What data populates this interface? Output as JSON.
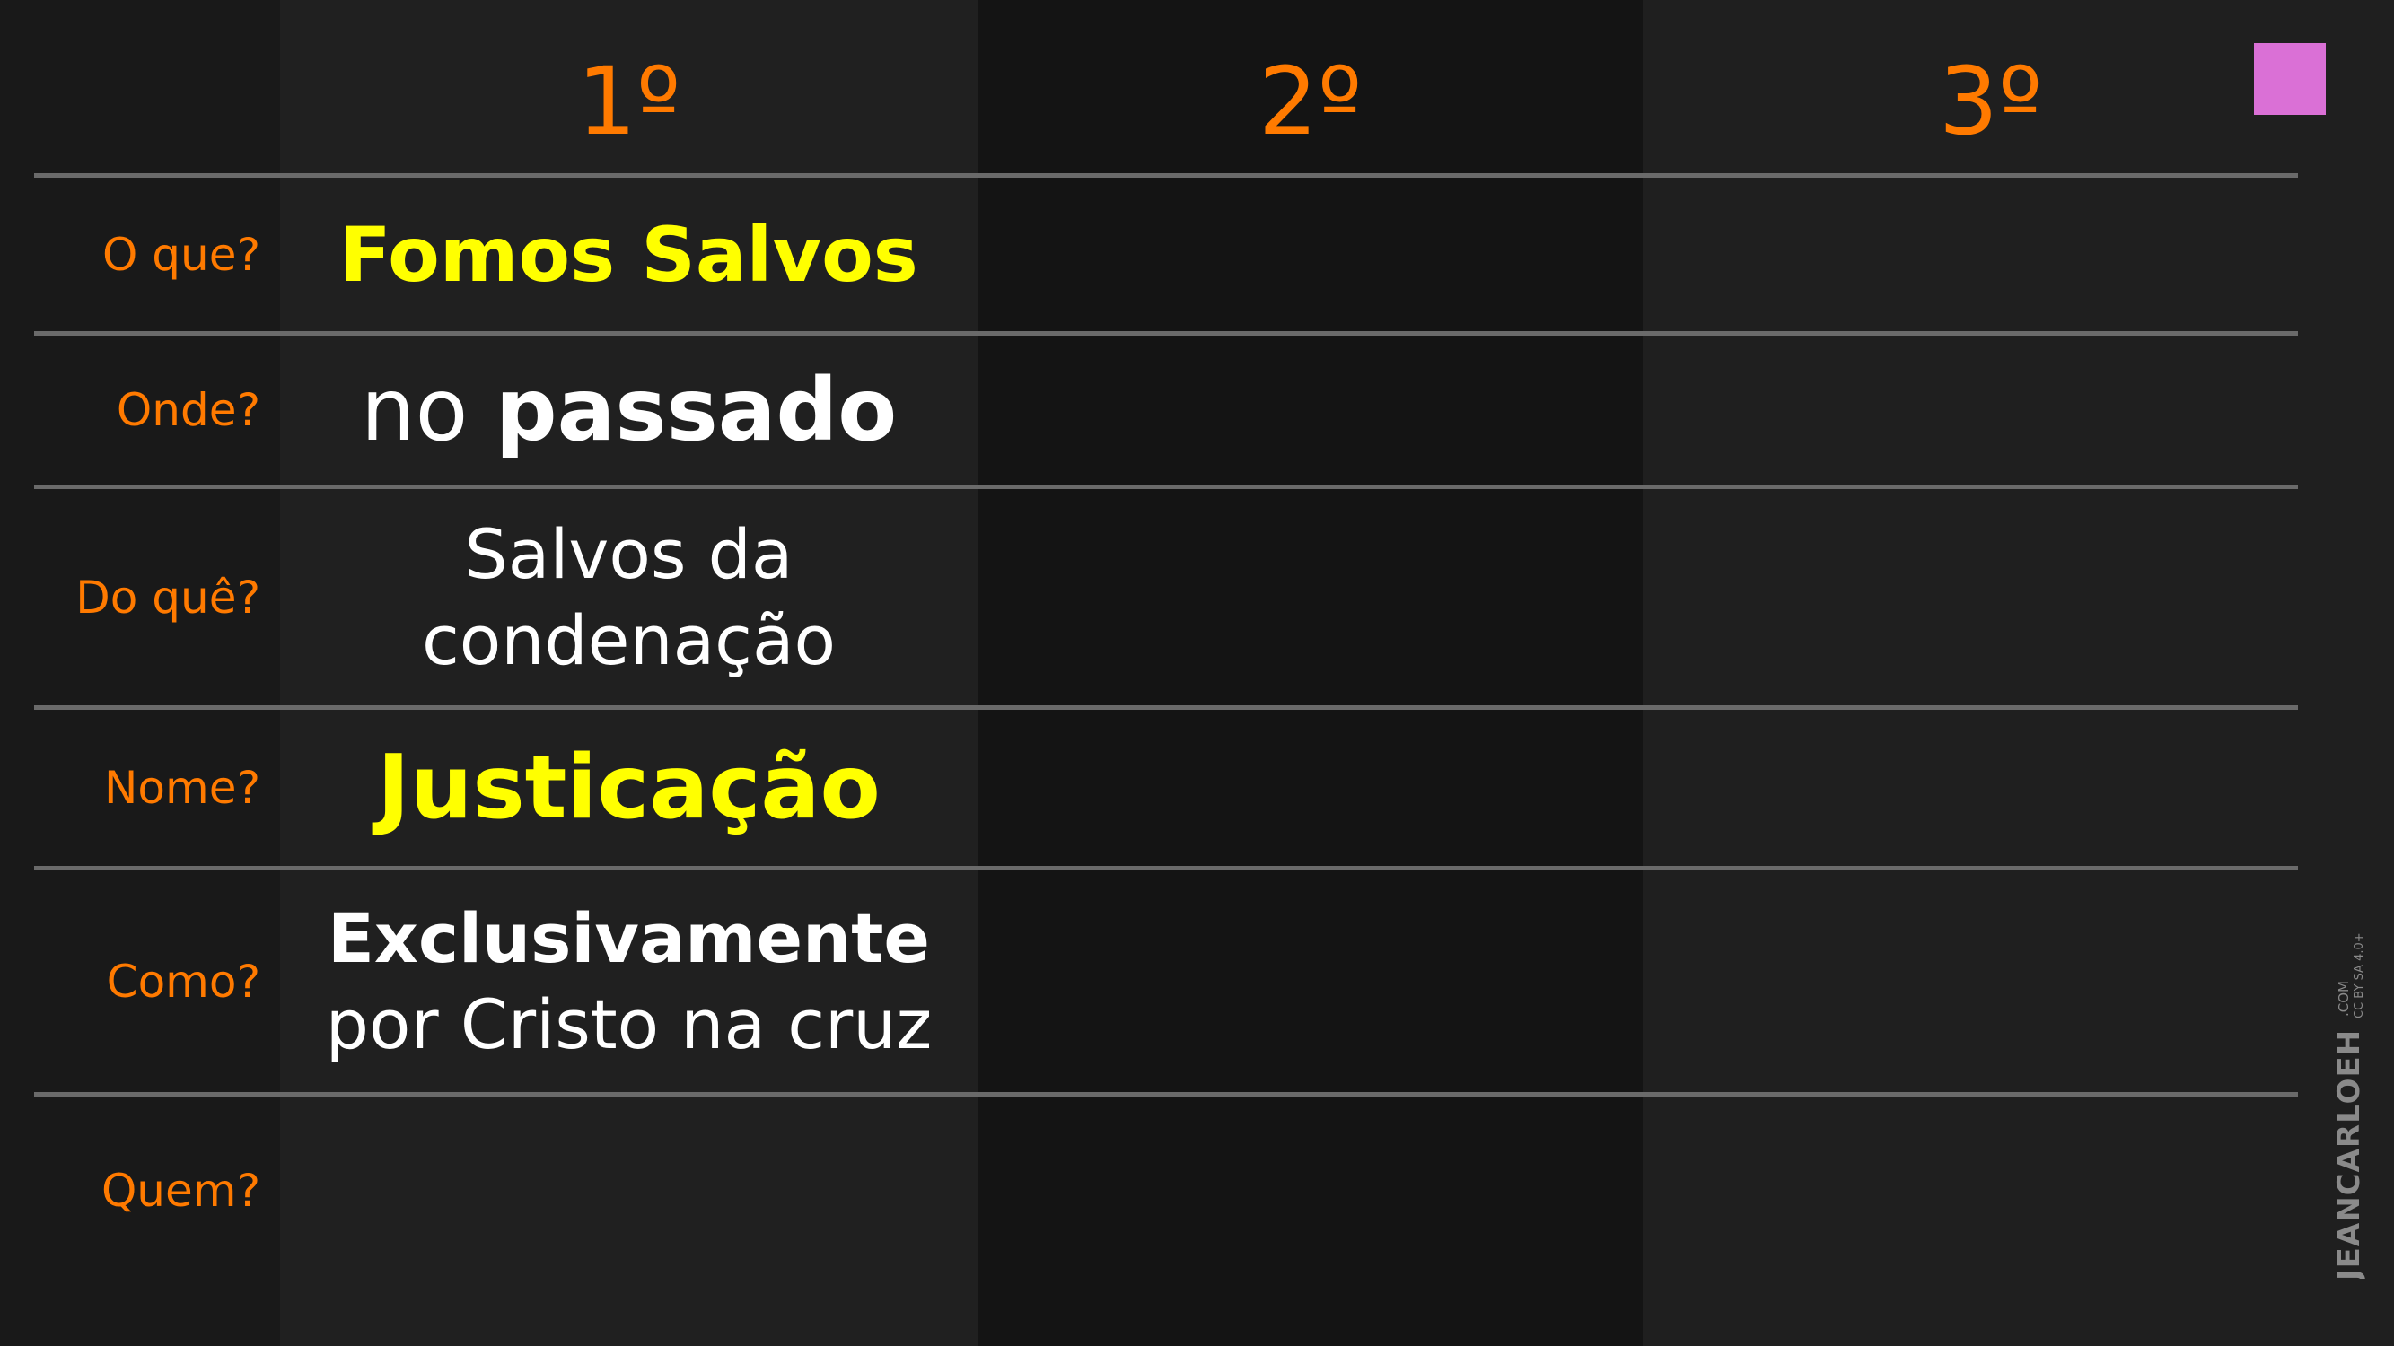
{
  "columns": {
    "c1": "1º",
    "c2": "2º",
    "c3": "3º"
  },
  "rows": {
    "what": {
      "label": "O que?",
      "value": "Fomos Salvos"
    },
    "where": {
      "label": "Onde?",
      "value_regular": "no",
      "value_bold": "passado"
    },
    "from_what": {
      "label": "Do quê?",
      "line1": "Salvos da",
      "line2": "condenação"
    },
    "name": {
      "label": "Nome?",
      "value": "Justicação"
    },
    "how": {
      "label": "Como?",
      "line1": "Exclusivamente",
      "line2": "por Cristo na cruz"
    },
    "who": {
      "label": "Quem?"
    }
  },
  "watermark": {
    "brand": "JEANCARLOEH",
    "suffix": ".COM",
    "license": "CC BY SA 4.0+"
  },
  "colors": {
    "accent_orange": "#ff7a00",
    "highlight_yellow": "#ffff00",
    "marker_pink": "#da70d6"
  }
}
